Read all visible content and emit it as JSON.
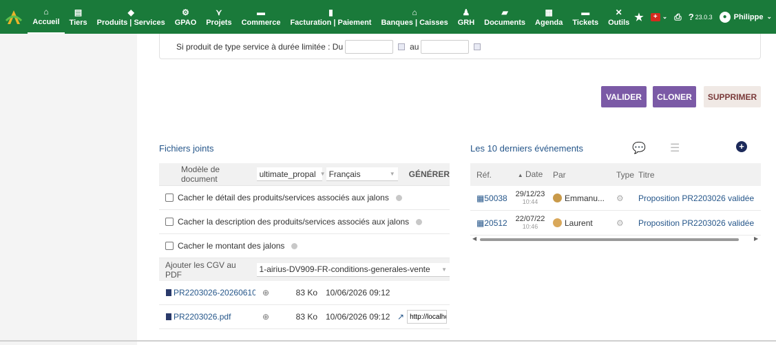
{
  "nav": {
    "items": [
      {
        "icon": "home-icon",
        "glyph": "⌂",
        "label": "Accueil"
      },
      {
        "icon": "building-icon",
        "glyph": "▤",
        "label": "Tiers"
      },
      {
        "icon": "cube-icon",
        "glyph": "◆",
        "label": "Produits | Services"
      },
      {
        "icon": "cogs-icon",
        "glyph": "⚙",
        "label": "GPAO"
      },
      {
        "icon": "sitemap-icon",
        "glyph": "⋎",
        "label": "Projets"
      },
      {
        "icon": "briefcase-icon",
        "glyph": "▬",
        "label": "Commerce"
      },
      {
        "icon": "invoice-icon",
        "glyph": "▮",
        "label": "Facturation | Paiement"
      },
      {
        "icon": "bank-icon",
        "glyph": "⌂",
        "label": "Banques | Caisses"
      },
      {
        "icon": "users-icon",
        "glyph": "♟",
        "label": "GRH"
      },
      {
        "icon": "folder-icon",
        "glyph": "▰",
        "label": "Documents"
      },
      {
        "icon": "calendar-icon",
        "glyph": "▦",
        "label": "Agenda"
      },
      {
        "icon": "ticket-icon",
        "glyph": "▬",
        "label": "Tickets"
      },
      {
        "icon": "tools-icon",
        "glyph": "✕",
        "label": "Outils"
      }
    ],
    "right": {
      "version": "23.0.3",
      "user": "Philippe"
    }
  },
  "form": {
    "service_label": "Si produit de type service à durée limitée : Du",
    "au_label": "au",
    "from_value": "",
    "to_value": ""
  },
  "actions": {
    "valider": "VALIDER",
    "cloner": "CLONER",
    "supprimer": "SUPPRIMER"
  },
  "files": {
    "title": "Fichiers joints",
    "model_label": "Modèle de document",
    "model_value": "ultimate_propal",
    "lang_value": "Français",
    "generate": "GÉNÉRER",
    "options": [
      "Cacher le détail des produits/services associés aux jalons",
      "Cacher la description des produits/services associés aux jalons",
      "Cacher le montant des jalons"
    ],
    "cgv_label": "Ajouter les CGV au PDF",
    "cgv_value": "1-airius-DV909-FR-conditions-generales-vente",
    "list": [
      {
        "name": "PR2203026-20260610:...",
        "size": "83 Ko",
        "date": "10/06/2026 09:12",
        "link": ""
      },
      {
        "name": "PR2203026.pdf",
        "size": "83 Ko",
        "date": "10/06/2026 09:12",
        "link": "http://localhc"
      }
    ]
  },
  "events": {
    "title": "Les 10 derniers événements",
    "headers": {
      "ref": "Réf.",
      "date": "Date",
      "par": "Par",
      "type": "Type",
      "titre": "Titre"
    },
    "rows": [
      {
        "ref": "50038",
        "date": "29/12/23",
        "time": "10:44",
        "par": "Emmanu...",
        "titre": "Proposition PR2203026 validée"
      },
      {
        "ref": "20512",
        "date": "22/07/22",
        "time": "10:46",
        "par": "Laurent",
        "titre": "Proposition PR2203026 validée"
      }
    ]
  },
  "colors": {
    "nav": "#1a7a3a",
    "accent_purple": "#7b5aa6",
    "link": "#25568a"
  }
}
